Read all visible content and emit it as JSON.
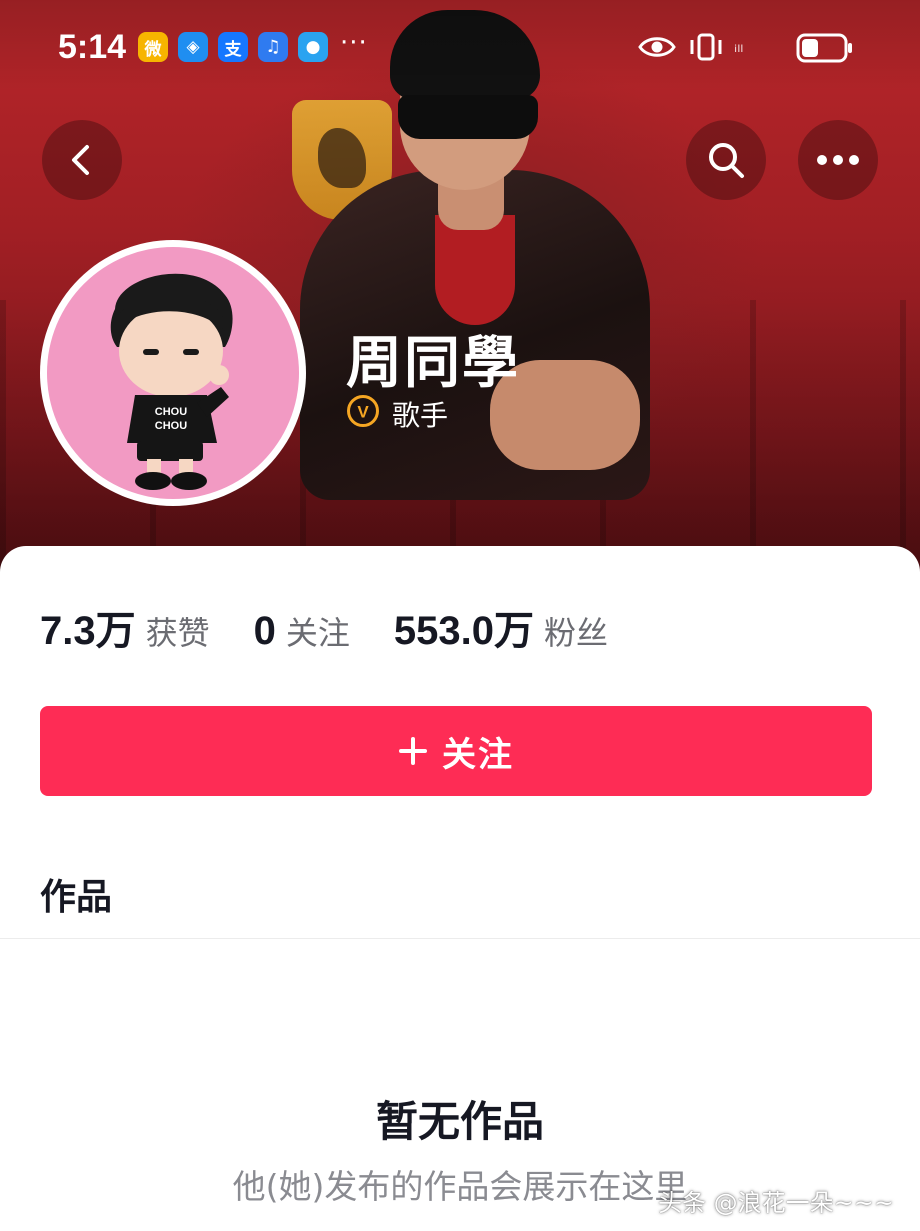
{
  "status_bar": {
    "time": "5:14",
    "more": "···",
    "signal": "ᵢₗₗ",
    "battery_percent": 0.4,
    "apps": [
      {
        "name": "weibo",
        "glyph": "微",
        "color": "#f7b500"
      },
      {
        "name": "shield-app",
        "glyph": "◈",
        "color": "#1f8ef1"
      },
      {
        "name": "alipay",
        "glyph": "支",
        "color": "#1677ff"
      },
      {
        "name": "music-app",
        "glyph": "♫",
        "color": "#2f7bf0"
      },
      {
        "name": "message-app",
        "glyph": "●",
        "color": "#2aa3f0"
      }
    ]
  },
  "nav": {
    "back_icon": "chevron-left-icon",
    "search_icon": "search-icon",
    "more_icon": "more-dots-icon"
  },
  "profile": {
    "name": "周同學",
    "tag": "歌手",
    "badge_letter": "V",
    "avatar_shirt_text": "CHOU CHOU",
    "colors": {
      "avatar_bg": "#f29ac3",
      "badge": "#f5a623"
    }
  },
  "stats": [
    {
      "value": "7.3万",
      "label": "获赞"
    },
    {
      "value": "0",
      "label": "关注"
    },
    {
      "value": "553.0万",
      "label": "粉丝"
    }
  ],
  "follow_button": {
    "label": "关注",
    "color": "#fe2c55"
  },
  "works": {
    "section_title": "作品",
    "empty_title": "暂无作品",
    "empty_desc": "他(她)发布的作品会展示在这里"
  },
  "watermark": "头条 @浪花一朵~~~"
}
